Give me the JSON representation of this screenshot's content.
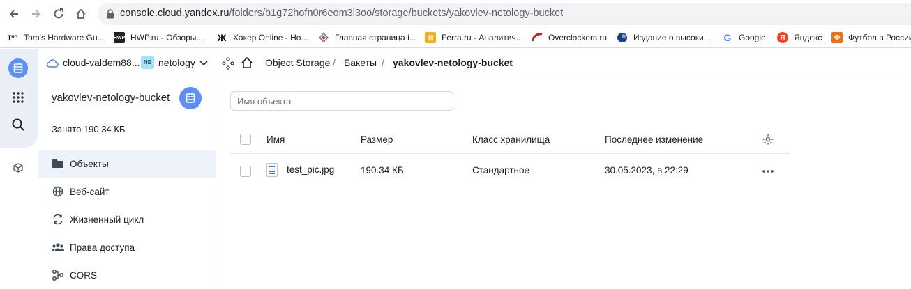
{
  "browser": {
    "url_host": "console.cloud.yandex.ru",
    "url_path": "/folders/b1g72hofn0r6eom3l3oo/storage/buckets/yakovlev-netology-bucket",
    "bookmarks": [
      {
        "label": "Tom's Hardware Gu..."
      },
      {
        "label": "HWP.ru - Обзоры..."
      },
      {
        "label": "Хакер Online - Но..."
      },
      {
        "label": "Главная страница i..."
      },
      {
        "label": "Ferra.ru - Аналитич..."
      },
      {
        "label": "Overclockers.ru"
      },
      {
        "label": "Издание о высоки..."
      },
      {
        "label": "Google"
      },
      {
        "label": "Яндекс"
      },
      {
        "label": "Футбол в России"
      }
    ]
  },
  "topbar": {
    "cloud": "cloud-valdem88...",
    "folder_badge": "NE",
    "folder": "netology",
    "breadcrumb": [
      "Object Storage",
      "Бакеты",
      "yakovlev-netology-bucket"
    ],
    "separator": "/"
  },
  "sidebar": {
    "bucket_name": "yakovlev-netology-bucket",
    "occupied": "Занято 190.34 КБ",
    "items": [
      {
        "label": "Объекты",
        "icon": "folder-icon",
        "active": true
      },
      {
        "label": "Веб-сайт",
        "icon": "globe-icon"
      },
      {
        "label": "Жизненный цикл",
        "icon": "cycle-icon"
      },
      {
        "label": "Права доступа",
        "icon": "users-icon"
      },
      {
        "label": "CORS",
        "icon": "cors-icon"
      }
    ]
  },
  "main": {
    "search_placeholder": "Имя объекта",
    "columns": [
      "Имя",
      "Размер",
      "Класс хранилища",
      "Последнее изменение"
    ],
    "rows": [
      {
        "name": "test_pic.jpg",
        "size": "190.34 КБ",
        "class": "Стандартное",
        "modified": "30.05.2023, в 22:29"
      }
    ]
  },
  "colors": {
    "accent": "#5f8ff0",
    "active_menu": "#eef2fa"
  }
}
